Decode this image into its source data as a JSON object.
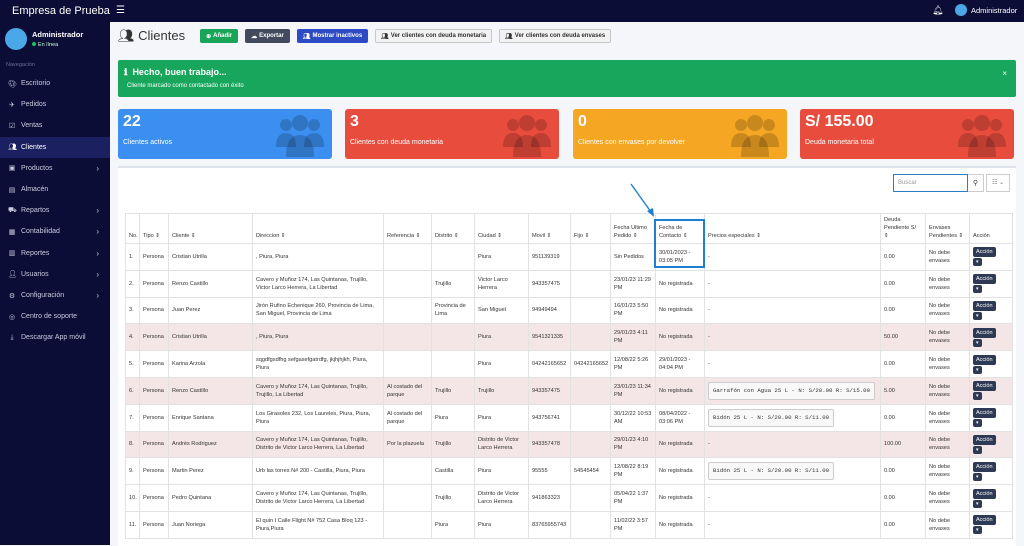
{
  "brand": "Empresa de Prueba",
  "topbar": {
    "user": "Administrador"
  },
  "sidebar": {
    "user_name": "Administrador",
    "status": "En línea",
    "nav_label": "Navegación",
    "items": [
      {
        "label": "Escritorio",
        "icon": "palette-icon",
        "chev": false
      },
      {
        "label": "Pedidos",
        "icon": "plane-icon",
        "chev": false
      },
      {
        "label": "Ventas",
        "icon": "check-square-icon",
        "chev": false
      },
      {
        "label": "Clientes",
        "icon": "users-icon",
        "chev": false,
        "active": true
      },
      {
        "label": "Productos",
        "icon": "box-icon",
        "chev": true
      },
      {
        "label": "Almacén",
        "icon": "warehouse-icon",
        "chev": false
      },
      {
        "label": "Repartos",
        "icon": "truck-icon",
        "chev": true
      },
      {
        "label": "Contabilidad",
        "icon": "calculator-icon",
        "chev": true
      },
      {
        "label": "Reportes",
        "icon": "chart-icon",
        "chev": true
      },
      {
        "label": "Usuarios",
        "icon": "user-icon",
        "chev": true
      },
      {
        "label": "Configuración",
        "icon": "cogs-icon",
        "chev": true
      },
      {
        "label": "Centro de soporte",
        "icon": "lifebuoy-icon",
        "chev": false
      },
      {
        "label": "Descargar App móvil",
        "icon": "download-icon",
        "chev": false
      }
    ]
  },
  "page_title": "Clientes",
  "buttons": {
    "add": "Añadir",
    "export": "Exportar",
    "inactive": "Mostrar inactivos",
    "debt_money": "Ver clientes con deuda monetaria",
    "debt_env": "Ver clientes con deuda envases"
  },
  "alert": {
    "title": "Hecho, buen trabajo...",
    "message": "Cliente marcado como contactado con éxito",
    "close": "×"
  },
  "cards": [
    {
      "value": "22",
      "label": "Clientes activos",
      "color": "#3b8ff0"
    },
    {
      "value": "3",
      "label": "Clientes con deuda monetaria",
      "color": "#e84c3d"
    },
    {
      "value": "0",
      "label": "Clientes con envases por devolver",
      "color": "#f5a623"
    },
    {
      "value": "S/ 155.00",
      "label": "Deuda monetaria total",
      "color": "#e84c3d"
    }
  ],
  "search": {
    "placeholder": "Buscar",
    "cols": "☷ ⌄"
  },
  "table": {
    "headers": [
      "No.",
      "Tipo ⇕",
      "Cliente ⇕",
      "Direccion ⇕",
      "Referencia ⇕",
      "Distrito ⇕",
      "Ciudad ⇕",
      "Movil ⇕",
      "Fijo ⇕",
      "Fecha Ultimo Pedido ⇕",
      "Fecha de Contacto ⇕",
      "Precios especiales ⇕",
      "Deuda Pendiente S/ ⇕",
      "Envases Pendientes ⇕",
      "Acción"
    ],
    "action": "Acción",
    "rows": [
      {
        "pk": false,
        "c": [
          "1.",
          "Persona",
          "Cristian Utrilla",
          ", Piura, Piura",
          "",
          "",
          "Piura",
          "951139319",
          "",
          "Sin Pedidos",
          "30/01/2023 - 03:05 PM",
          "-",
          "0.00",
          "No debe envases"
        ]
      },
      {
        "pk": false,
        "c": [
          "2.",
          "Persona",
          "Renzo Castillo",
          "Cavero y Muñoz 174, Las Quintanas, Trujillo, Victor Larco Herrera, La Libertad",
          "",
          "Trujillo",
          "Victor Larco Herrera",
          "943357475",
          "",
          "23/01/23 11:29 PM",
          "No registrada",
          "-",
          "0.00",
          "No debe envases"
        ]
      },
      {
        "pk": false,
        "c": [
          "3.",
          "Persona",
          "Juan Perez",
          "Jirón Rufino Echenique 260, Provincia de Lima, San Miguel, Provincia de Lima",
          "",
          "Provincia de Lima",
          "San Miguel",
          "94949494",
          "",
          "16/01/23 5:50 PM",
          "No registrada",
          "-",
          "0.00",
          "No debe envases"
        ]
      },
      {
        "pk": true,
        "c": [
          "4.",
          "Persona",
          "Cristian Utrilla",
          ", Piura, Piura",
          "",
          "",
          "Piura",
          "9541321335",
          "",
          "29/01/23 4:11 PM",
          "No registrada",
          "-",
          "50.00",
          "No debe envases"
        ]
      },
      {
        "pk": false,
        "c": [
          "5.",
          "Persona",
          "Karina Arzola",
          "sqgdfgsdfhg sefgasefgatrdfg, jkjhjhjkh, Piura, Piura",
          "",
          "",
          "Piura",
          "04242165652",
          "04242165652",
          "12/08/22 5:26 PM",
          "29/01/2023 - 04:04 PM",
          "-",
          "0.00",
          "No debe envases"
        ]
      },
      {
        "pk": true,
        "c": [
          "6.",
          "Persona",
          "Renzo Castillo",
          "Cavero y Muñoz 174, Las Quintanas, Trujillo, Trujillo, La Libertad",
          "Al costado del parque",
          "Trujillo",
          "Trujillo",
          "943357475",
          "",
          "23/01/23 11:34 PM",
          "No registrada",
          "Garrafón con Agua 25 L -  N: S/20.00 R: S/15.00",
          "5.00",
          "No debe envases"
        ]
      },
      {
        "pk": false,
        "c": [
          "7.",
          "Persona",
          "Enrique Santana",
          "Los Girasoles 232, Los Laureles, Piura, Piura, Piura",
          "Al costado del parque",
          "Piura",
          "Piura",
          "943756741",
          "",
          "30/12/22 10:53 AM",
          "08/04/2022 - 03:06 PM",
          "Bidón 25 L -  N: S/20.00 R: S/11.00",
          "0.00",
          "No debe envases"
        ]
      },
      {
        "pk": true,
        "c": [
          "8.",
          "Persona",
          "Andrés Rodriguez",
          "Cavero y Muñoz 174, Las Quintanas, Trujillo, Distrito de Victor Larco Herrera, La Libertad",
          "Por la plazuela",
          "Trujillo",
          "Distrito de Victor Larco Herrera",
          "943357478",
          "",
          "29/01/23 4:10 PM",
          "No registrada",
          "-",
          "100.00",
          "No debe envases"
        ]
      },
      {
        "pk": false,
        "c": [
          "9.",
          "Persona",
          "Martin Perez",
          "Urb las torres N# 200 - Castilla, Piura, Piura",
          "",
          "Castilla",
          "Piura",
          "95555",
          "54545454",
          "12/08/22 8:19 PM",
          "No registrada",
          "Bidón 25 L -  N: S/20.00 R: S/11.00",
          "0.00",
          "No debe envases"
        ]
      },
      {
        "pk": false,
        "c": [
          "10.",
          "Persona",
          "Pedro Quintana",
          "Cavero y Muñoz 174, Las Quintanas, Trujillo, Distrito de Victor Larco Herrera, La Libertad",
          "",
          "Trujillo",
          "Distrito de Victor Larco Herrera",
          "941863323",
          "",
          "05/04/22 1:37 PM",
          "No registrada",
          "-",
          "0.00",
          "No debe envases"
        ]
      },
      {
        "pk": false,
        "c": [
          "11.",
          "Persona",
          "Juan Noriega",
          "El quin I Calle Flight N# 752 Casa Bloq 123 - Piura,Piura",
          "",
          "Piura",
          "Piura",
          "83765955743",
          "",
          "11/02/22 3:57 PM",
          "No registrada",
          "-",
          "0.00",
          "No debe envases"
        ]
      }
    ]
  }
}
